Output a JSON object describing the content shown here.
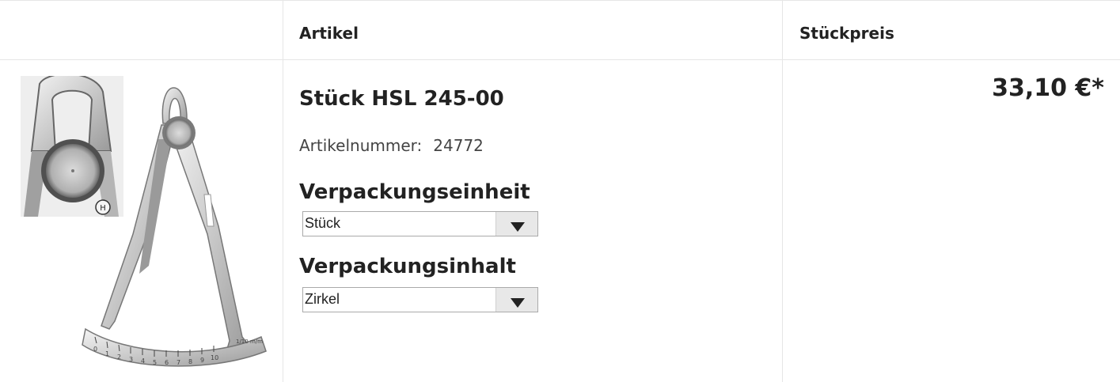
{
  "header": {
    "article_col": "Artikel",
    "price_col": "Stückpreis"
  },
  "item": {
    "title": "Stück HSL 245-00",
    "artno_label": "Artikelnummer:",
    "artno_value": "24772",
    "packaging_unit_label": "Verpackungseinheit",
    "packaging_unit_value": "Stück",
    "packaging_content_label": "Verpackungsinhalt",
    "packaging_content_value": "Zirkel",
    "price": "33,10 €*",
    "image_icon": "caliper-gauge-image",
    "scale_labels": [
      "0",
      "1",
      "2",
      "3",
      "4",
      "5",
      "6",
      "7",
      "8",
      "9",
      "10"
    ],
    "scale_unit": "1/10 m/m",
    "brand_mark": "H"
  }
}
